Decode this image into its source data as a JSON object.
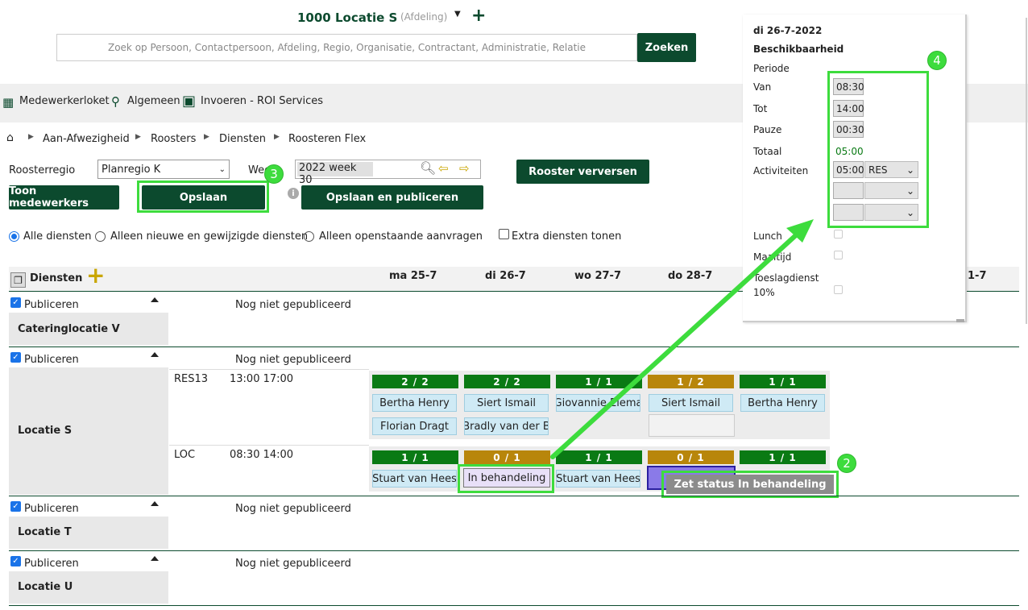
{
  "header": {
    "location_title": "1000 Locatie S",
    "location_type": "(Afdeling)",
    "search_placeholder": "Zoek op Persoon, Contactpersoon, Afdeling, Regio, Organisatie, Contractant, Administratie, Relatie",
    "search_button": "Zoeken"
  },
  "menu": {
    "items": [
      "Medewerkerloket",
      "Algemeen",
      "Invoeren - ROI Services"
    ]
  },
  "breadcrumb": [
    "Aan-Afwezigheid",
    "Roosters",
    "Diensten",
    "Roosteren Flex"
  ],
  "filters": {
    "roosterregio_label": "Roosterregio",
    "roosterregio_value": "Planregio K",
    "week_label": "Week",
    "week_value": "2022 week 30",
    "refresh_button": "Rooster verversen"
  },
  "actions": {
    "toon_medewerkers": "Toon medewerkers",
    "opslaan": "Opslaan",
    "opslaan_publiceren": "Opslaan en publiceren"
  },
  "radios": [
    "Alle diensten",
    "Alleen nieuwe en gewijzigde diensten",
    "Alleen openstaande aanvragen"
  ],
  "extra_checkbox": "Extra diensten tonen",
  "grid": {
    "title": "Diensten",
    "days": [
      "ma 25-7",
      "di 26-7",
      "wo 27-7",
      "do 28-7",
      "1-7"
    ],
    "publiceren": "Publiceren",
    "not_published": "Nog niet gepubliceerd",
    "groups": [
      "Cateringlocatie V",
      "Locatie S",
      "Locatie T",
      "Locatie U"
    ],
    "rows": [
      {
        "code": "RES13",
        "time": "13:00 17:00",
        "counts": [
          "2 / 2",
          "2 / 2",
          "1 / 1",
          "1 / 2",
          "1 / 1"
        ],
        "names1": [
          "Bertha Henry",
          "Siert Ismail",
          "Giovannie Elema",
          "Siert Ismail",
          "Bertha Henry"
        ],
        "names2": [
          "Florian Dragt",
          "Bradly van der B"
        ]
      },
      {
        "code": "LOC",
        "time": "08:30 14:00",
        "counts": [
          "1 / 1",
          "0 / 1",
          "1 / 1",
          "0 / 1",
          "1 / 1"
        ],
        "names1": [
          "Stuart van Hees",
          "In behandeling",
          "Stuart van Hees"
        ]
      }
    ]
  },
  "context_menu": {
    "item": "Zet status In behandeling"
  },
  "popup": {
    "date": "di 26-7-2022",
    "title": "Beschikbaarheid",
    "periode": "Periode",
    "van_label": "Van",
    "van_value": "08:30",
    "tot_label": "Tot",
    "tot_value": "14:00",
    "pauze_label": "Pauze",
    "pauze_value": "00:30",
    "totaal_label": "Totaal",
    "totaal_value": "05:00",
    "activiteiten_label": "Activiteiten",
    "act_time": "05:00",
    "act_code": "RES",
    "lunch": "Lunch",
    "maaltijd": "Maaltijd",
    "toeslag1": "Toeslagdienst",
    "toeslag2": "10%"
  },
  "badges": [
    "2",
    "3",
    "4"
  ],
  "colors": {
    "primary": "#0c4a2e",
    "ok": "#0a7a14",
    "partial": "#b8860b",
    "highlight": "#3ddc3d"
  }
}
